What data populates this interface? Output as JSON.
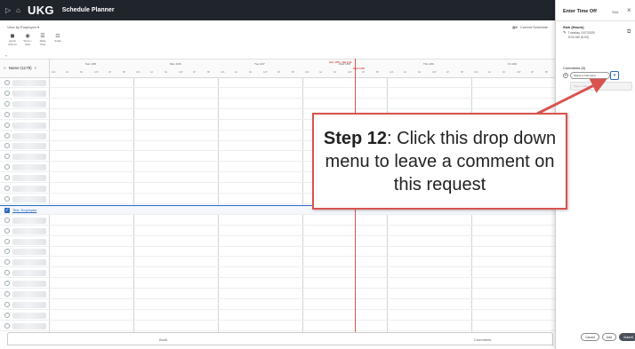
{
  "header": {
    "logo": "UKG",
    "app_title": "Schedule Planner"
  },
  "viewbar": {
    "view_label": "View by Employee ▾",
    "schedule_label": "Current Schedule"
  },
  "toolbar": {
    "tools": [
      {
        "icon": "quick-actions-icon",
        "label": "Quick Actions"
      },
      {
        "icon": "show-hide-icon",
        "label": "Show / Hide"
      },
      {
        "icon": "table-view-icon",
        "label": "Table View"
      },
      {
        "icon": "scale-icon",
        "label": "Scale"
      }
    ]
  },
  "grid": {
    "name_header": "Name (1179)",
    "range_label": "Sun 1/05 - Sat 1/11",
    "today_label": "Wed 1/08",
    "days": [
      "Sun 1/05",
      "Mon 1/06",
      "Tue 1/07",
      "Wed 1/08",
      "Thu 1/09",
      "Fri 1/10"
    ],
    "hour_labels": [
      "12A",
      "4A",
      "8A",
      "12P",
      "4P",
      "8P"
    ],
    "selected_employee": "Test, Employee"
  },
  "bottom": {
    "tab_build": "Build",
    "tab_comments": "Comments"
  },
  "panel": {
    "title": "Enter Time Off",
    "type_short": "Sick",
    "type_full": "Sick (Hours)",
    "date": "Tuesday 1/07/2025",
    "time": "8:00 AM (8.00)",
    "comments_label": "Comments (0)",
    "select_placeholder": "Select a Comment",
    "note_placeholder": "Type a note (optional)",
    "buttons": {
      "cancel": "Cancel",
      "add": "Add",
      "submit": "Submit"
    }
  },
  "callout": {
    "step": "Step 12",
    "text": ": Click this drop down menu to leave a comment on this request"
  },
  "colors": {
    "header_bg": "#20252c",
    "accent": "#2d6cc0",
    "callout_border": "#d9534f"
  }
}
